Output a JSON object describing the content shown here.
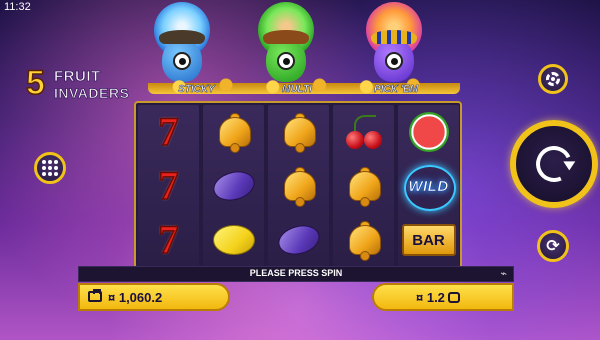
{
  "status_bar": {
    "time": "11:32"
  },
  "logo": {
    "number": "5",
    "word1": "FRUIT",
    "word2": "INVADERS"
  },
  "features": [
    {
      "label": "STICKY",
      "color": "#3ab0e8"
    },
    {
      "label": "MULTI",
      "color": "#38c83a"
    },
    {
      "label": "PICK 'EM",
      "color": "#f08a2a"
    }
  ],
  "reels": [
    [
      "seven",
      "seven",
      "seven"
    ],
    [
      "bell",
      "plum",
      "lemon"
    ],
    [
      "bell",
      "bell",
      "plum"
    ],
    [
      "cherry",
      "bell",
      "bell"
    ],
    [
      "watermelon",
      "wild",
      "bar"
    ]
  ],
  "symbols": {
    "wild_label": "WILD",
    "bar_label": "BAR"
  },
  "message": "PLEASE PRESS SPIN",
  "balance": {
    "amount": "¤ 1,060.2",
    "icon": "wallet-icon"
  },
  "bet": {
    "amount": "¤ 1.2",
    "icon": "coin-stack-icon"
  },
  "controls": {
    "menu": "menu-grid-icon",
    "settings": "gear-icon",
    "spin": "spin-arrow-icon",
    "autoplay": "autoplay-icon"
  },
  "colors": {
    "accent": "#f2b80f",
    "frame": "#c79a2b"
  }
}
